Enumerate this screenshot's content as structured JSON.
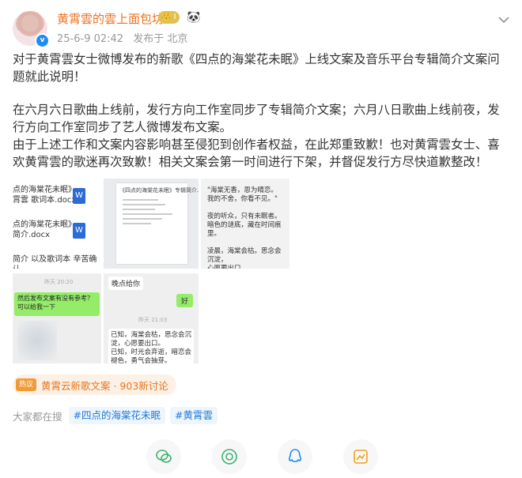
{
  "header": {
    "name": "黄霄雲的雲上面包坊",
    "level_badge": "👑 I",
    "verified_mark": "v",
    "time": "25-6-9 02:42",
    "source": "发布于 北京"
  },
  "post": {
    "paragraph1": "对于黄霄雲女士微博发布的新歌《四点的海棠花未眠》上线文案及音乐平台专辑简介文案问题就此说明！",
    "paragraph2": "在六月六日歌曲上线前，发行方向工作室同步了专辑简介文案；六月八日歌曲上线前夜，发行方向工作室同步了艺人微博发布文案。",
    "paragraph3": "由于上述工作和文案内容影响甚至侵犯到创作者权益，在此郑重致歉！也对黄霄雲女士、喜欢黄霄雲的歌迷再次致歉！相关文案会第一时间进行下架，并督促发行方尽快道歉整改！"
  },
  "images": {
    "img1": {
      "doc1_line1": "点的海棠花未眠》",
      "doc1_line2": "霄雲 歌词本.docx",
      "doc2_line1": "点的海棠花未眠》",
      "doc2_line2": "简介.docx",
      "caption": "简介 以及歌词本 辛苦确认",
      "word_icon": "W"
    },
    "img2": {
      "sheet_title": "《四点的海棠花未眠》专辑简介.docx"
    },
    "img3": {
      "poem": "\"海棠无香，恩为晴恋。\n我的不舍，你看不见。\"\n\n夜的听众，只有未眠者。\n暗色的谜底，藏在时间痕里。\n\n凌晨，海棠会枯。思念会沉淀，\n心愿要出口。\n已知，时光会弃逝，暗恋会褪\n色，勇气会抽芽。\n沉默无声，于是歌要替予它到\n达。"
    },
    "img4": {
      "time": "昨天 20:20",
      "message": "然后发布文案有没有参考？可以给我一下"
    },
    "img5": {
      "message_top": "晚点给你",
      "reply": "好",
      "time": "昨天 21:03",
      "block": "已知，海棠会枯，思念会沉淀，心愿要出口。\n已知，时光会弃逝，暗恋会褪色，勇气会抽芽。\n沉默无声，于是歌要替予它到达"
    }
  },
  "topic": {
    "hot_label": "热议",
    "text": "黄霄云新歌文案 · 903新讨论"
  },
  "people": {
    "label": "大家都在搜",
    "tags": [
      "#四点的海棠花未眠",
      "#黄霄雲"
    ]
  },
  "colors": {
    "name": "#f07020",
    "link": "#1f7ad8",
    "topic": "#e8741c",
    "icon_gray": "#999999"
  },
  "icons": [
    "wechat-icon",
    "moments-icon",
    "qq-icon",
    "poster-icon",
    "chevron-down-icon",
    "panda-icon",
    "verified-icon"
  ]
}
